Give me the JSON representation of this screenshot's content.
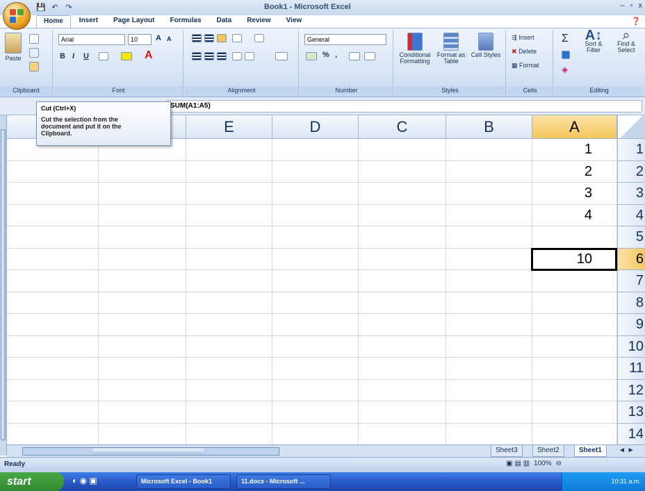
{
  "window": {
    "title": "Book1 - Microsoft Excel",
    "controls": [
      "–",
      "▫",
      "x"
    ]
  },
  "quick_access": [
    "💾",
    "↶",
    "↷"
  ],
  "tabs": [
    {
      "label": "Home",
      "active": true
    },
    {
      "label": "Insert"
    },
    {
      "label": "Page Layout"
    },
    {
      "label": "Formulas"
    },
    {
      "label": "Data"
    },
    {
      "label": "Review"
    },
    {
      "label": "View"
    }
  ],
  "ribbon": {
    "clipboard": {
      "label": "Clipboard",
      "paste": "Paste"
    },
    "font": {
      "label": "Font",
      "name": "Arial",
      "size": "10"
    },
    "alignment": {
      "label": "Alignment"
    },
    "number": {
      "label": "Number",
      "format": "General"
    },
    "styles": {
      "label": "Styles",
      "conditional": "Conditional Formatting",
      "format_table": "Format as Table",
      "cell_styles": "Cell Styles"
    },
    "cells": {
      "label": "Cells",
      "insert": "Insert",
      "delete": "Delete",
      "format": "Format"
    },
    "editing": {
      "label": "Editing",
      "sort": "Sort & Filter",
      "find": "Find & Select"
    }
  },
  "formula_bar": {
    "formula": "SUM(A1:A5)"
  },
  "tooltip": {
    "title": "Cut (Ctrl+X)",
    "body": "Cut the selection from the document and put it on the Clipboard."
  },
  "columns": [
    {
      "label": "",
      "width": 132
    },
    {
      "label": "",
      "width": 126
    },
    {
      "label": "E",
      "width": 124
    },
    {
      "label": "D",
      "width": 124
    },
    {
      "label": "C",
      "width": 126
    },
    {
      "label": "B",
      "width": 124
    },
    {
      "label": "A",
      "width": 122,
      "selected": true
    }
  ],
  "rows": [
    {
      "n": "1",
      "a": "1"
    },
    {
      "n": "2",
      "a": "2"
    },
    {
      "n": "3",
      "a": "3"
    },
    {
      "n": "4",
      "a": "4"
    },
    {
      "n": "5",
      "a": ""
    },
    {
      "n": "6",
      "a": "10",
      "selected": true
    },
    {
      "n": "7",
      "a": ""
    },
    {
      "n": "8",
      "a": ""
    },
    {
      "n": "9",
      "a": ""
    },
    {
      "n": "10",
      "a": ""
    },
    {
      "n": "11",
      "a": ""
    },
    {
      "n": "12",
      "a": ""
    },
    {
      "n": "13",
      "a": ""
    },
    {
      "n": "14",
      "a": ""
    }
  ],
  "sheets": [
    {
      "label": "Sheet3"
    },
    {
      "label": "Sheet2"
    },
    {
      "label": "Sheet1",
      "active": true
    }
  ],
  "status": {
    "text": "Ready",
    "zoom": "100%"
  },
  "taskbar": {
    "start": "start",
    "tasks": [
      "Microsoft Excel - Book1",
      "11.docx - Microsoft ..."
    ],
    "clock": "10:31 a.m."
  },
  "colors": {
    "accent": "#2455c4",
    "selected_header": "#f5c65c"
  }
}
